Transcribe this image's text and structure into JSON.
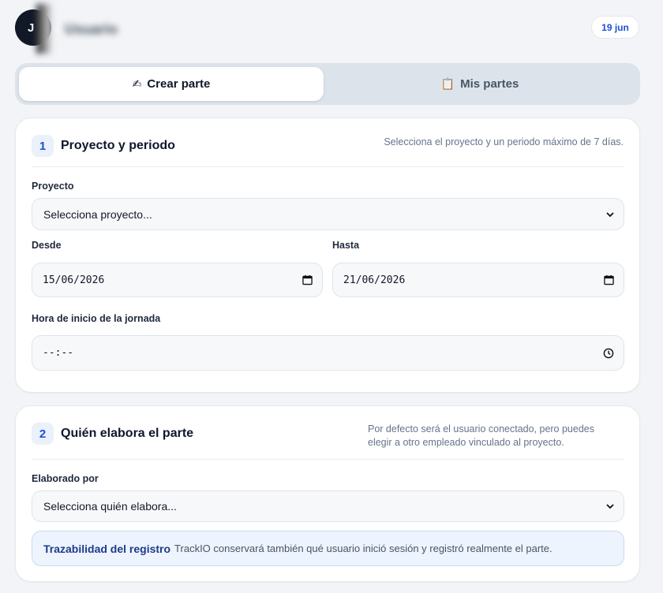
{
  "header": {
    "avatar_initial": "J",
    "user_name": "Usuario",
    "date_badge": "19 jun"
  },
  "tabs": [
    {
      "label": "Crear parte",
      "icon": "writing-hand-icon",
      "glyph": "✍",
      "active": true
    },
    {
      "label": "Mis partes",
      "icon": "clipboard-icon",
      "glyph": "📋",
      "active": false
    }
  ],
  "section1": {
    "number": "1",
    "title": "Proyecto y periodo",
    "hint": "Selecciona el proyecto y un periodo máximo de 7 días.",
    "proyecto_label": "Proyecto",
    "proyecto_value": "Selecciona proyecto...",
    "desde_label": "Desde",
    "desde_value": "15/06/2026",
    "hasta_label": "Hasta",
    "hasta_value": "21/06/2026",
    "hora_label": "Hora de inicio de la jornada",
    "hora_value": "--:--"
  },
  "section2": {
    "number": "2",
    "title": "Quién elabora el parte",
    "hint": "Por defecto será el usuario conectado, pero puedes elegir a otro empleado vinculado al proyecto.",
    "elaborado_label": "Elaborado por",
    "elaborado_value": "Selecciona quién elabora...",
    "info_title": "Trazabilidad del registro",
    "info_text": "TrackIO conservará también qué usuario inició sesión y registró realmente el parte."
  },
  "colors": {
    "accent": "#1d4ed8",
    "background": "#f2f4f7",
    "info_bg": "#eef4fd"
  }
}
